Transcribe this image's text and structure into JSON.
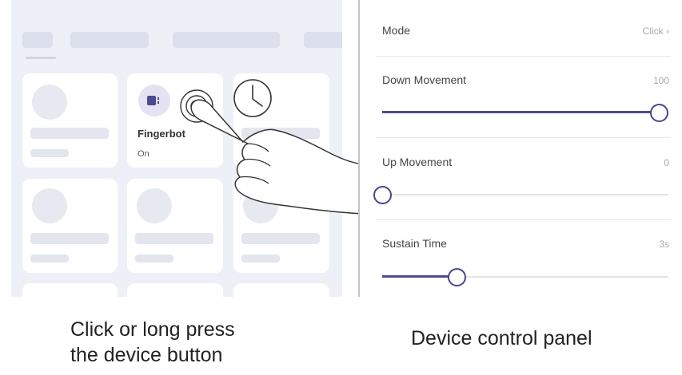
{
  "device_card": {
    "name": "Fingerbot",
    "status": "On"
  },
  "panel": {
    "mode": {
      "label": "Mode",
      "value": "Click ›"
    },
    "sliders": [
      {
        "label": "Down Movement",
        "value": "100",
        "level": 1.0
      },
      {
        "label": "Up Movement",
        "value": "0",
        "level": 0.0
      },
      {
        "label": "Sustain Time",
        "value": "3s",
        "level": 0.27
      }
    ]
  },
  "captions": {
    "left_line1": "Click or long press",
    "left_line2": "the device button",
    "right": "Device control panel"
  },
  "colors": {
    "accent": "#4b4b8f",
    "background_left": "#eef0f8"
  },
  "icons": [
    "device-icon",
    "clock-icon",
    "touch-ripple-icon",
    "hand-pointer-icon",
    "chevron-right-icon"
  ]
}
